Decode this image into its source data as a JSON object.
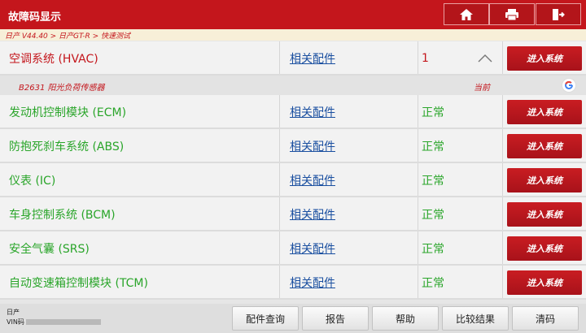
{
  "header": {
    "title": "故障码显示",
    "buttons": [
      {
        "name": "home",
        "icon": "home-icon"
      },
      {
        "name": "print",
        "icon": "printer-icon"
      },
      {
        "name": "exit",
        "icon": "exit-icon"
      }
    ]
  },
  "breadcrumb": "日产 V44.40 > 日产GT-R > 快速测试",
  "systems": [
    {
      "name": "空调系统 (HVAC)",
      "parts": "相关配件",
      "status": "1",
      "enter": "进入系统",
      "color": "#c4161c",
      "expanded": true
    },
    {
      "name": "发动机控制模块 (ECM)",
      "parts": "相关配件",
      "status": "正常",
      "enter": "进入系统",
      "color": "#2aa52a"
    },
    {
      "name": "防抱死刹车系统 (ABS)",
      "parts": "相关配件",
      "status": "正常",
      "enter": "进入系统",
      "color": "#2aa52a"
    },
    {
      "name": "仪表 (IC)",
      "parts": "相关配件",
      "status": "正常",
      "enter": "进入系统",
      "color": "#2aa52a"
    },
    {
      "name": "车身控制系统 (BCM)",
      "parts": "相关配件",
      "status": "正常",
      "enter": "进入系统",
      "color": "#2aa52a"
    },
    {
      "name": "安全气囊 (SRS)",
      "parts": "相关配件",
      "status": "正常",
      "enter": "进入系统",
      "color": "#2aa52a"
    },
    {
      "name": "自动变速箱控制模块 (TCM)",
      "parts": "相关配件",
      "status": "正常",
      "enter": "进入系统",
      "color": "#2aa52a"
    }
  ],
  "dtc": {
    "code": "B2631 阳光负荷传感器",
    "state": "当前",
    "icon": "google-search-icon"
  },
  "footer": {
    "vehicle_make": "日产",
    "vin_label": "VIN码",
    "buttons": [
      "配件查询",
      "报告",
      "帮助",
      "比较结果",
      "清码"
    ]
  },
  "colors": {
    "brand_red": "#c4161c",
    "ok_green": "#2aa52a",
    "link_blue": "#1a4fa0"
  }
}
